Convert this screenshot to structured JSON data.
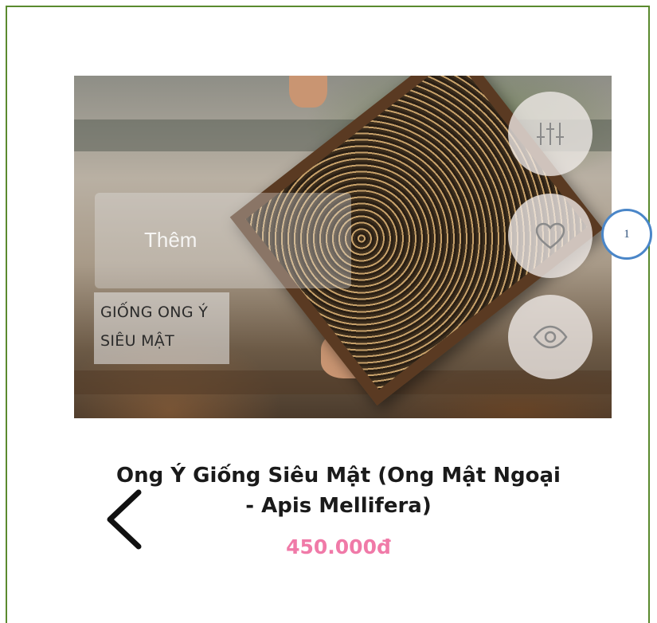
{
  "product": {
    "image_alt": "beekeeper holding honeycomb frame covered with bees",
    "add_overlay_text": "Thêm",
    "breed_label_line1": "GIỐNG ONG Ý",
    "breed_label_line2": "SIÊU MẬT",
    "title_line1": "Ong Ý Giống Siêu Mật (Ong Mật Ngoại",
    "title_line2": "- Apis Mellifera)",
    "price": "450.000đ"
  },
  "actions": {
    "compare_icon": "sliders-icon",
    "wishlist_icon": "heart-icon",
    "quickview_icon": "eye-icon"
  },
  "annotation": {
    "badge_label": "1"
  },
  "colors": {
    "price": "#f07aa8",
    "frame_border": "#5a8a2e",
    "badge_border": "#4a86c8"
  }
}
